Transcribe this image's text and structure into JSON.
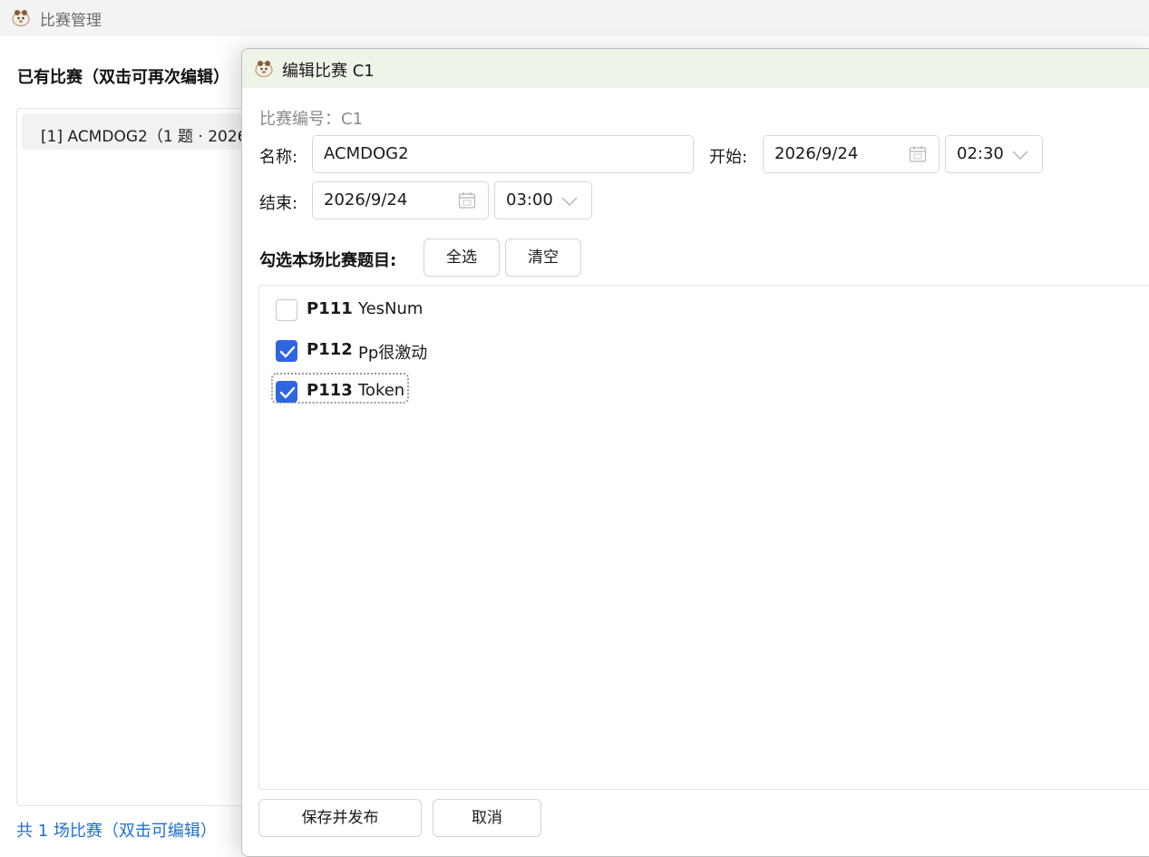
{
  "main_window": {
    "title": "比赛管理",
    "list_heading": "已有比赛（双击可再次编辑）",
    "list_items": [
      "[1] ACMDOG2（1 题 · 2026"
    ],
    "footer_count": "共 1 场比赛（双击可编辑）"
  },
  "dialog": {
    "title": "编辑比赛 C1",
    "contest_id": "比赛编号：C1",
    "name_label": "名称:",
    "name_value": "ACMDOG2",
    "start_label": "开始:",
    "start_date": "2026/9/24",
    "start_time": "02:30",
    "end_label": "结束:",
    "end_date": "2026/9/24",
    "end_time": "03:00",
    "problems_label": "勾选本场比赛题目:",
    "select_all": "全选",
    "clear": "清空",
    "problems": [
      {
        "code": "P111",
        "title": "YesNum",
        "checked": false
      },
      {
        "code": "P112",
        "title": "Pp很激动",
        "checked": true
      },
      {
        "code": "P113",
        "title": "Token",
        "checked": true
      }
    ],
    "save_button": "保存并发布",
    "cancel_button": "取消"
  },
  "colors": {
    "accent": "#2f66e0",
    "link": "#1f6fd0",
    "dialog_titlebar": "#eef4e8"
  },
  "icons": {
    "app": "app-logo-icon",
    "date": "calendar-icon",
    "dropdown": "chevron-down-icon",
    "check": "checkmark-icon"
  }
}
